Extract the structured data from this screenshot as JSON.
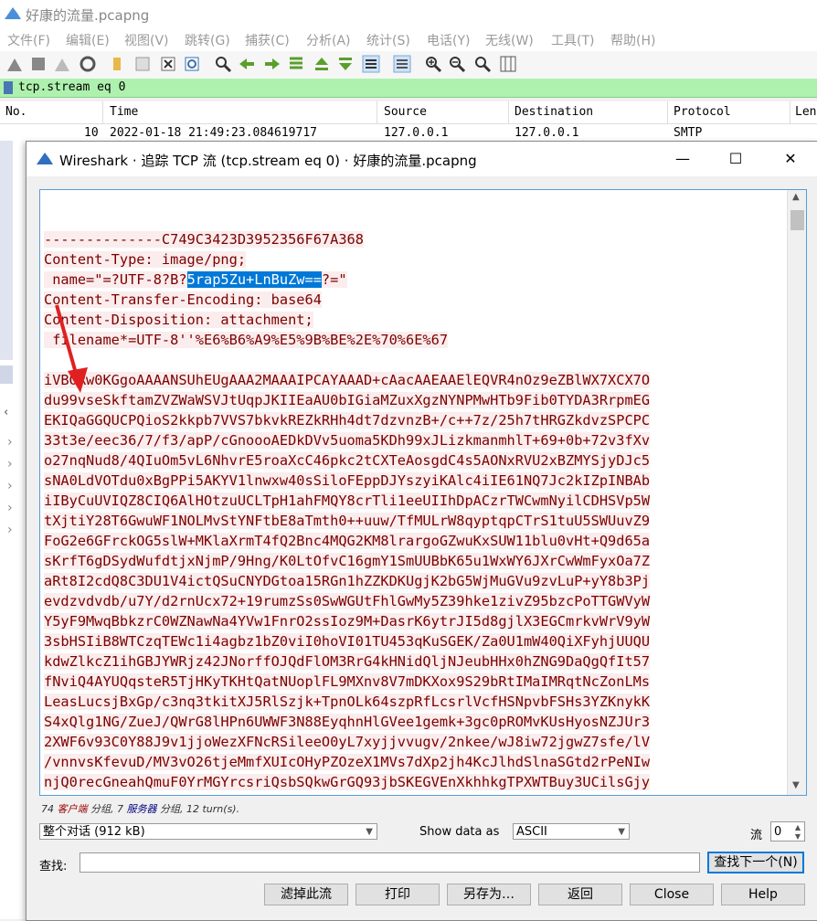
{
  "app": {
    "window_title": "好康的流量.pcapng",
    "menu": [
      "文件(F)",
      "编辑(E)",
      "视图(V)",
      "跳转(G)",
      "捕获(C)",
      "分析(A)",
      "统计(S)",
      "电话(Y)",
      "无线(W)",
      "工具(T)",
      "帮助(H)"
    ],
    "filter_text": "tcp.stream eq 0",
    "packet_columns": [
      "No.",
      "Time",
      "Source",
      "Destination",
      "Protocol",
      "Len"
    ],
    "packet_row": {
      "no": "10",
      "time": "2022-01-18 21:49:23.084619717",
      "source": "127.0.0.1",
      "destination": "127.0.0.1",
      "protocol": "SMTP"
    }
  },
  "dialog": {
    "title": "Wireshark · 追踪 TCP 流 (tcp.stream eq 0) · 好康的流量.pcapng",
    "lines": [
      "--------------C749C3423D3952356F67A368",
      "Content-Type: image/png;",
      " name=\"=?UTF-8?B?",
      "Content-Transfer-Encoding: base64",
      "Content-Disposition: attachment;",
      " filename*=UTF-8''%E6%B6%A9%E5%9B%BE%2E%70%6E%67",
      "",
      "iVBORw0KGgoAAAANSUhEUgAAA2MAAAIPCAYAAAD+cAacAAEAAElEQVR4nOz9eZBlWX7XCX7O",
      "du99vseSkftamZVZWaWSVJtUqpJKIIEaAU0bIGiaMZuxXgzNYNPMwHTb9Fib0TYDA3RrpmEG",
      "EKIQaGGQUCPQioS2kkpb7VVS7bkvkREZkRHh4dt7dzvnzB+/c++7z/25h7tHRGZkdvzSPCPC",
      "33t3e/eec36/7/f3/apP/cGnoooAEDkDVv5uoma5KDh99xJLizkmanmhlT+69+0b+72v3fXv",
      "o27nqNud8/4QIuOm5vL6NhvrE5roaXcC46pkc2tCXTeAosgdC4s5AONxRVU2xBZMYSjyDJc5",
      "sNA0LdVOTdu0xBgPPi5AKYV1lnwxw40sSiloFEppDJYszyiKAlc4iIE61NQ7Jc2kIZpINBAb",
      "iIByCuUVIQZ8CIQ6AlHOtzuUCLTpH1ahFMQY8crTli1eeUIIhDpACzrTWCwmNyilCDHSVp5W",
      "tXjtiY28T6GwuWF1NOLMvStYNFtbE8aTmth0++uuw/TfMULrW8qyptqpCTrS1tuU5SWUuvZ9",
      "FoG2e6GFrckOG5slW+MKlaXrmT4fQ2Bnc4MQG2KM8lrargoGZwuKxSUW11blu0vHt+Q9d65a",
      "sKrfT6gDSydWufdtjxNjmP/9Hng/K0LtOfvC16gmY1SmUUBbK65u1WxWY6JXrCwWmFyxOa7Z",
      "aRt8I2cdQ8C3DU1V4ictQSuCNYDGtoa15RGn1hZZKDKUgjK2bG5WjMuGVu9zvLuP+yY8b3Pj",
      "evdzvdvdb/u7Y/d2rnUcx72+19rumzSs0SwWGUtFhlGwMy5Z39hke1zivZ95bzcPoTTGWVyW",
      "Y5yF9MwqBbkzrC0WZNawNa4YVw1FnrO2ssIoz9M+DasrK6ytrJI5d8gjlX3EGCmrkvWrV9yW",
      "3sbHSIiB8WTCzqTEWc1i4agbz1bZ0viI0hoVI01TU453qKuSGEK/Za0U1mW40QiXFyhjUUQU",
      "kdwZlkcZ1ihGBJYWRjz42JNorffOJQdFlOM3RrG4kHNidQljNJeubHHx0hZNG9DaQgQfIt57",
      "fNviQ4AYUQqsteR5TjHKyTKHtQatNUoplFL9MXnv8V7mDKXox9S29bRtIMaIMRqtNcZonLMs",
      "LeasLucsjBxGp/c3nq3tkitXJ5RlSzjk+TpnOLk64szpRfLcsrlVcfHSNpvbFSHs3YZKnykK",
      "S4xQlg1NG/ZueJ/QWrG8lHPn6UWWF3N88EyqhnHlGVee1gemk+3gc0pROMvKUsHyosNZJUr3",
      "2XWF6v93C0Y88J9v1jjoWezXFNcRSileeO0yL7xyjjvvugv/2nkee/wJ8iw72jgwZ7sfe/lV",
      "/vnnvsKfevuD/MV3vO26tjeMmfXUIcOHyPZOzeX1MVs7dXp2jh4KcJlhdSlnaSGtd2rPeNIw",
      "njQ0recGneahQmuF0YrMGYrcsriQsbSQkwGrGQ93jbSKEGVEnXkhhkgTPXWTBuy3UCilsGjy"
    ],
    "selected_text": "5rap5Zu+LnBuZw==",
    "name_suffix": "?=\"",
    "stats": {
      "client_count": "74",
      "client_label": "客户端",
      "pkt1": "分组,",
      "server_count": "7",
      "server_label": "服务器",
      "pkt2": "分组,",
      "turns": "12 turn(s)."
    },
    "conversation_select": "整个对话 (912 kB)",
    "show_data_as_label": "Show data as",
    "show_data_as_value": "ASCII",
    "stream_label": "流",
    "stream_value": "0",
    "find_label": "查找:",
    "find_value": "",
    "find_next_button": "查找下一个(N)",
    "buttons": {
      "filter_out": "滤掉此流",
      "print": "打印",
      "save_as": "另存为…",
      "back": "返回",
      "close": "Close",
      "help": "Help"
    }
  },
  "colors": {
    "filter_bg": "#aef1ae",
    "client_text": "#7c0000",
    "client_bg": "#fbeded",
    "selection": "#0078d7",
    "arrow": "#e02020"
  }
}
